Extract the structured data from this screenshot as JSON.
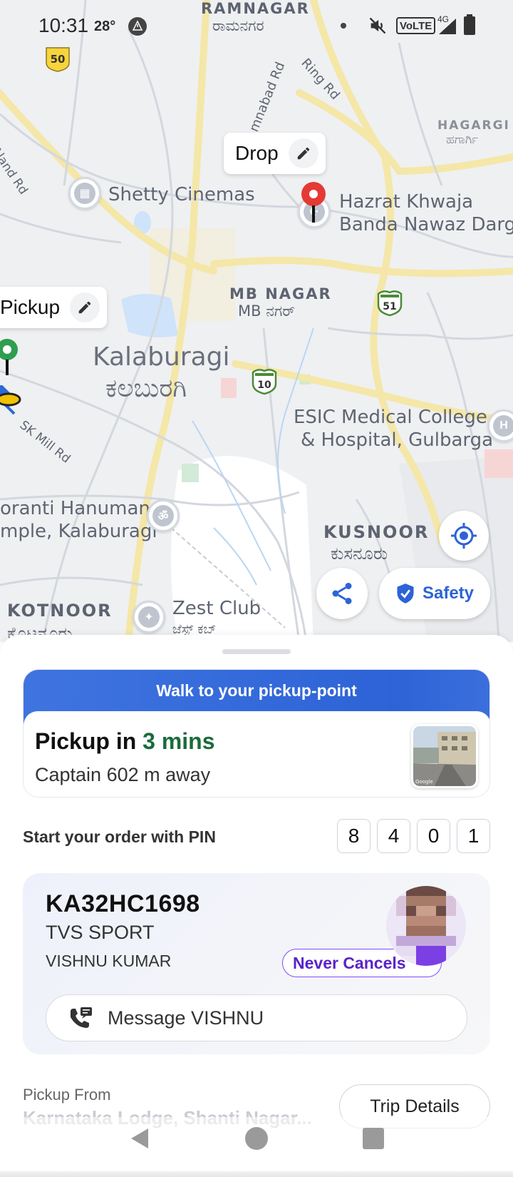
{
  "status_bar": {
    "time": "10:31",
    "temperature": "28°",
    "network_badge": "VoLTE",
    "network_type": "4G"
  },
  "map": {
    "labels": {
      "ramnagar": "RAMNAGAR",
      "ramnagar_kn": "ರಾಮನಗರ",
      "hagargi": "HAGARGI",
      "hagargi_kn": "ಹಗಾರ್ಗಿ",
      "aland_rd": "Aland Rd",
      "ring_rd": "Ring Rd",
      "humnabad_rd": "mnabad Rd",
      "shetty_cinemas": "Shetty Cinemas",
      "hazrat_line1": "Hazrat Khwaja",
      "hazrat_line2": "Banda Nawaz Darga",
      "mb_nagar": "MB NAGAR",
      "mb_nagar_kn": "MB ನಗರ್",
      "kalaburagi": "Kalaburagi",
      "kalaburagi_kn": "ಕಲಬುರಗಿ",
      "sk_mill_rd": "SK Mill Rd",
      "esic_line1": "ESIC Medical College",
      "esic_line2": "& Hospital, Gulbarga",
      "hanuman_line1": "oranti Hanuman",
      "hanuman_line2": "mple, Kalaburagi",
      "kusnoor": "KUSNOOR",
      "kusnoor_kn": "ಕುಸನೂರು",
      "kotnoor": "KOTNOOR",
      "kotnoor_kn": "ಕೊಟನೂರು",
      "zest_club": "Zest Club",
      "zest_club_kn": "ಜೆಸ್ಟ್ ಕಬ್"
    },
    "highway_shields": [
      "50",
      "51",
      "10"
    ],
    "drop_bubble_label": "Drop",
    "pickup_bubble_label": "Pickup",
    "share_icon": "share-icon",
    "safety_label": "Safety",
    "locate_icon": "my-location-icon"
  },
  "sheet": {
    "banner": "Walk to your pickup-point",
    "eta_prefix": "Pickup in ",
    "eta_value": "3 mins",
    "captain_distance": "Captain 602 m away",
    "pin_label": "Start your order with PIN",
    "pin_digits": [
      "8",
      "4",
      "0",
      "1"
    ],
    "vehicle_number": "KA32HC1698",
    "vehicle_model": "TVS SPORT",
    "driver_name": "VISHNU KUMAR",
    "driver_badge": "Never Cancels",
    "message_button": "Message VISHNU",
    "pickup_from_label": "Pickup From",
    "pickup_address": "Karnataka Lodge, Shanti Nagar...",
    "trip_details_button": "Trip Details",
    "street_view_credit": "Google"
  },
  "colors": {
    "accent_blue": "#2d63d6",
    "eta_green": "#1b6b3a",
    "badge_purple": "#7c4dff",
    "drop_pin_red": "#e53935",
    "pickup_pin_green": "#2e9e4f"
  }
}
